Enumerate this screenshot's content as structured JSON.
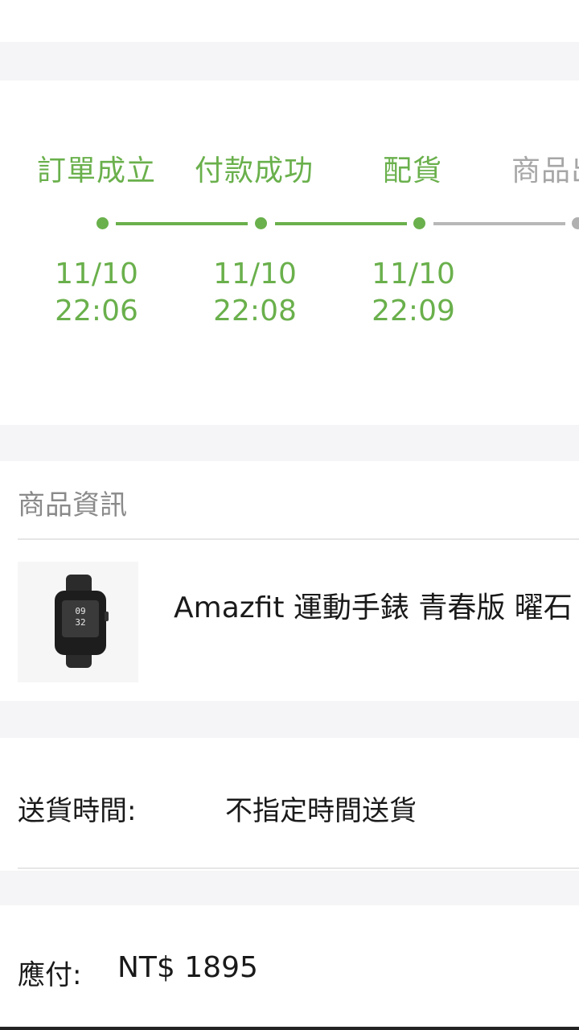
{
  "order_status": {
    "steps": [
      {
        "label": "訂單成立",
        "date": "11/10",
        "time": "22:06",
        "state": "done"
      },
      {
        "label": "付款成功",
        "date": "11/10",
        "time": "22:08",
        "state": "done"
      },
      {
        "label": "配貨",
        "date": "11/10",
        "time": "22:09",
        "state": "done"
      },
      {
        "label": "商品出",
        "date": "",
        "time": "",
        "state": "pending"
      }
    ]
  },
  "product_section": {
    "title": "商品資訊",
    "product_name": "Amazfit 運動手錶 青春版 曜石",
    "watch_display": {
      "hour": "09",
      "minute": "32"
    }
  },
  "delivery": {
    "label": "送貨時間:",
    "value": "不指定時間送貨"
  },
  "payment": {
    "label": "應付:",
    "amount": "NT$ 1895"
  },
  "colors": {
    "accent_green": "#6ab04c",
    "pending_gray": "#b0b0b0",
    "background": "#f5f5f7"
  }
}
